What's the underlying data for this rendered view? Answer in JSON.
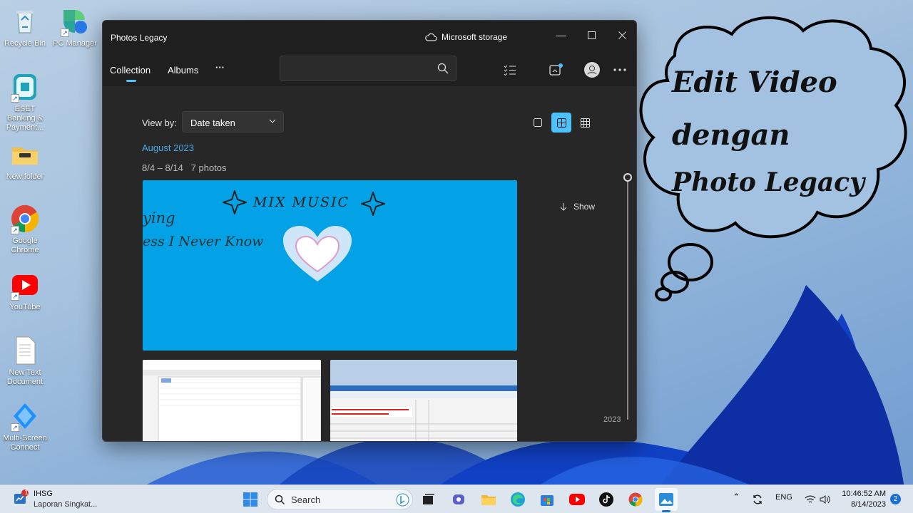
{
  "desktop": {
    "icons": [
      {
        "label": "Recycle Bin",
        "icon": "recycle-bin-icon"
      },
      {
        "label": "PC Manager",
        "icon": "pc-manager-icon"
      },
      {
        "label": "ESET Banking & Payment...",
        "icon": "eset-icon"
      },
      {
        "label": "New folder",
        "icon": "folder-icon"
      },
      {
        "label": "Google Chrome",
        "icon": "chrome-icon"
      },
      {
        "label": "YouTube",
        "icon": "youtube-icon"
      },
      {
        "label": "New Text Document",
        "icon": "text-document-icon"
      },
      {
        "label": "Multi-Screen Connect",
        "icon": "multi-screen-icon"
      }
    ]
  },
  "window": {
    "title": "Photos Legacy",
    "storage": "Microsoft storage",
    "tabs": [
      {
        "label": "Collection",
        "active": true
      },
      {
        "label": "Albums",
        "active": false
      }
    ],
    "more": "···",
    "search_placeholder": "",
    "view_by_label": "View by:",
    "view_by_value": "Date taken",
    "month": "August 2023",
    "range": "8/4 – 8/14   7 photos",
    "show_label": "Show",
    "year": "2023",
    "photo": {
      "title": "MIX MUSIC",
      "line1": "ying",
      "line2": "ess I Never Know"
    },
    "accent": "#4cc2ff"
  },
  "overlay": {
    "line1": "Edit Video",
    "line2": "dengan",
    "line3": "Photo Legacy"
  },
  "taskbar": {
    "widget_title": "IHSG",
    "widget_sub": "Laporan Singkat...",
    "widget_badge": "1",
    "search_label": "Search",
    "lang": "ENG",
    "time": "10:46:52 AM",
    "date": "8/14/2023",
    "notifications": "2"
  }
}
